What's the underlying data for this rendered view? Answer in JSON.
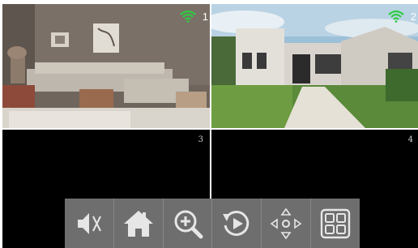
{
  "channels": [
    {
      "number": "1",
      "signal_icon": "wifi-icon",
      "signal_color": "#2ecc40",
      "feed": "living-room"
    },
    {
      "number": "2",
      "signal_icon": "wifi-icon",
      "signal_color": "#2ecc40",
      "feed": "house-exterior"
    },
    {
      "number": "3",
      "feed": "no-signal"
    },
    {
      "number": "4",
      "feed": "no-signal"
    }
  ],
  "toolbar": {
    "buttons": [
      {
        "name": "mute",
        "icon": "speaker-muted-icon"
      },
      {
        "name": "home",
        "icon": "home-icon"
      },
      {
        "name": "zoom",
        "icon": "zoom-in-icon"
      },
      {
        "name": "playback",
        "icon": "replay-icon"
      },
      {
        "name": "ptz",
        "icon": "ptz-arrows-icon"
      },
      {
        "name": "layout",
        "icon": "grid-layout-icon"
      }
    ],
    "background": "#6e6e6e",
    "icon_color": "#e6e6e6"
  }
}
